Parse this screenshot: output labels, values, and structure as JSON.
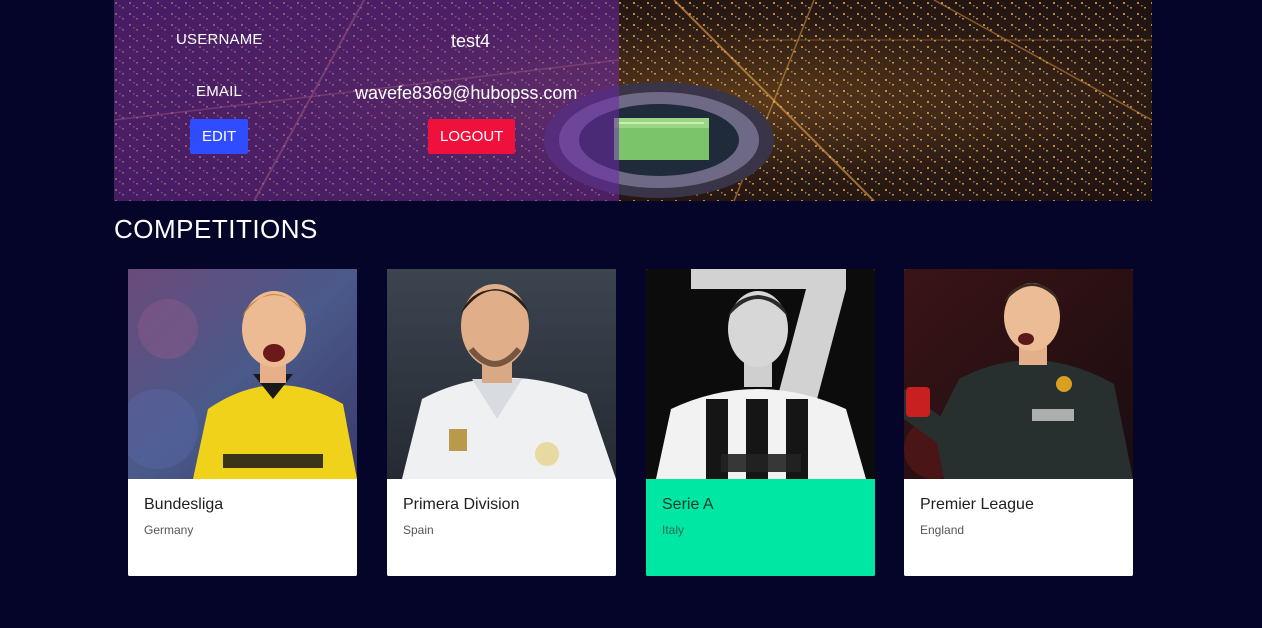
{
  "profile": {
    "username_label": "USERNAME",
    "username_value": "test4",
    "email_label": "EMAIL",
    "email_value": "wavefe8369@hubopss.com",
    "edit_label": "EDIT",
    "logout_label": "LOGOUT"
  },
  "colors": {
    "page_background": "#05052a",
    "edit_button": "#2f4cff",
    "logout_button": "#f0103c",
    "selected_card": "#00e6a3"
  },
  "competitions": {
    "title": "COMPETITIONS",
    "cards": [
      {
        "name": "Bundesliga",
        "country": "Germany",
        "selected": false
      },
      {
        "name": "Primera Division",
        "country": "Spain",
        "selected": false
      },
      {
        "name": "Serie A",
        "country": "Italy",
        "selected": true
      },
      {
        "name": "Premier League",
        "country": "England",
        "selected": false
      }
    ]
  }
}
